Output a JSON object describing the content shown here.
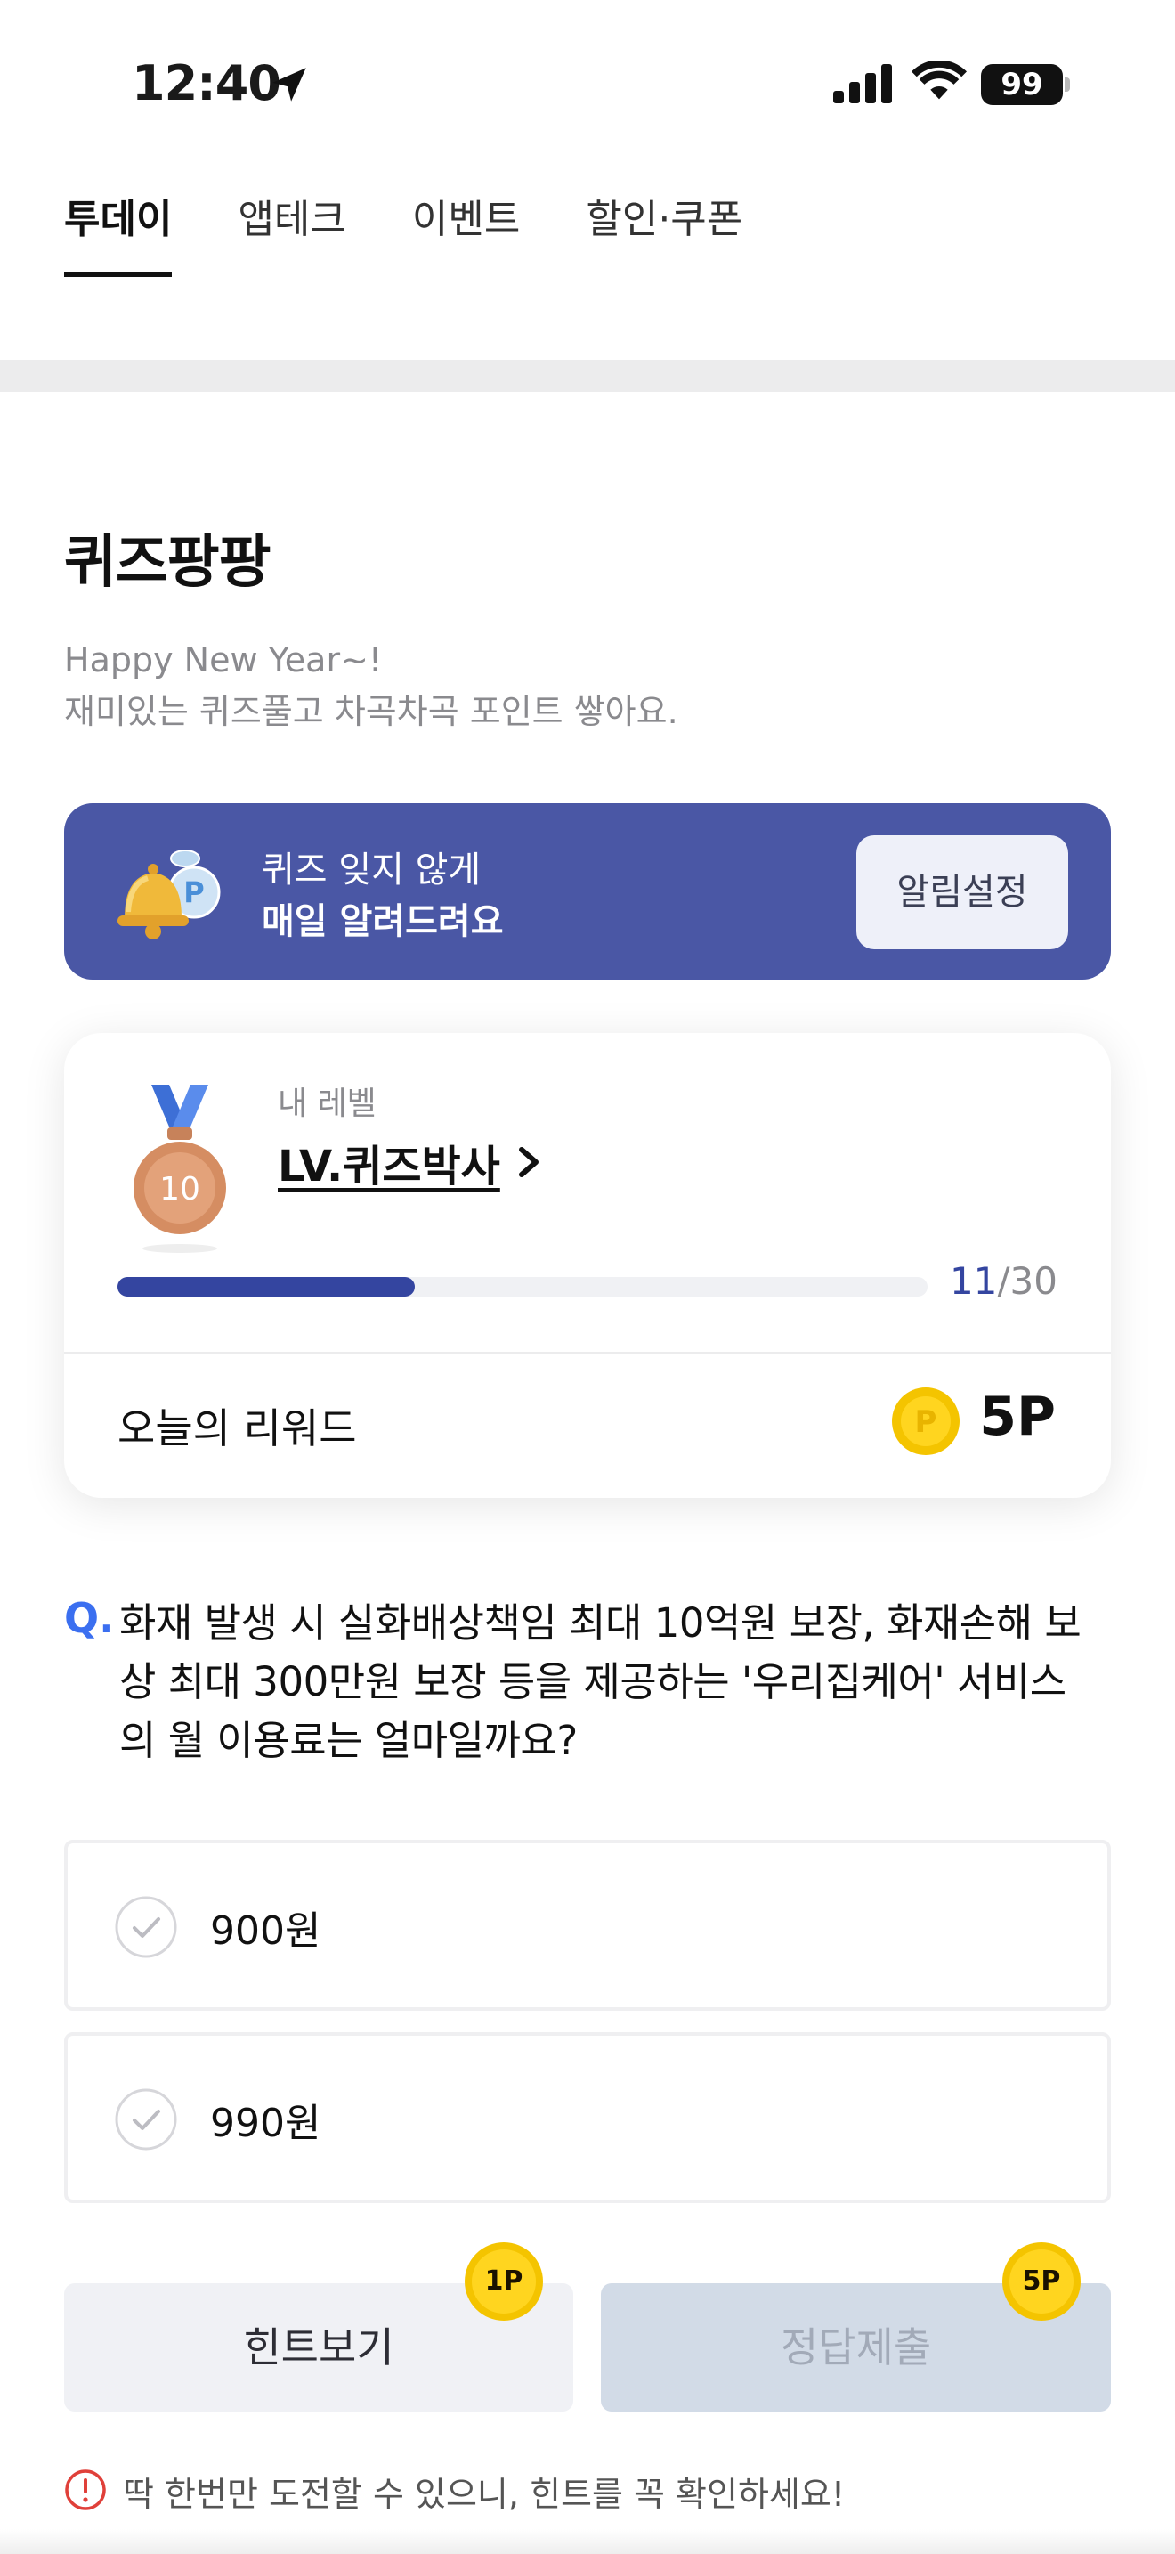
{
  "status_bar": {
    "time": "12:40",
    "battery": "99"
  },
  "tabs": [
    {
      "label": "투데이",
      "active": true
    },
    {
      "label": "앱테크",
      "active": false
    },
    {
      "label": "이벤트",
      "active": false
    },
    {
      "label": "할인·쿠폰",
      "active": false
    }
  ],
  "section": {
    "title": "퀴즈팡팡",
    "subtitle_line1": "Happy New Year~!",
    "subtitle_line2": "재미있는 퀴즈풀고 차곡차곡 포인트 쌓아요."
  },
  "banner": {
    "line1": "퀴즈 잊지 않게",
    "line2": "매일 알려드려요",
    "button_label": "알림설정",
    "color": "#4a57a5"
  },
  "level_card": {
    "caption": "내 레벨",
    "level_name": "LV.퀴즈박사",
    "medal_number": "10",
    "progress_current": "11",
    "progress_sep": "/",
    "progress_total": "30",
    "progress_fraction": 0.3667,
    "reward_label": "오늘의 리워드",
    "reward_value": "5P",
    "accent_color": "#3445a0"
  },
  "question": {
    "marker": "Q.",
    "text": "화재 발생 시 실화배상책임 최대 10억원 보장, 화재손해 보상 최대 300만원 보장 등을 제공하는 '우리집케어' 서비스의 월 이용료는 얼마일까요?"
  },
  "options": [
    {
      "label": "900원"
    },
    {
      "label": "990원"
    }
  ],
  "actions": {
    "hint_label": "힌트보기",
    "hint_cost": "1P",
    "submit_label": "정답제출",
    "submit_reward": "5P"
  },
  "warning": {
    "text": "딱 한번만 도전할 수 있으니, 힌트를 꼭 확인하세요!",
    "color": "#e0403a"
  }
}
